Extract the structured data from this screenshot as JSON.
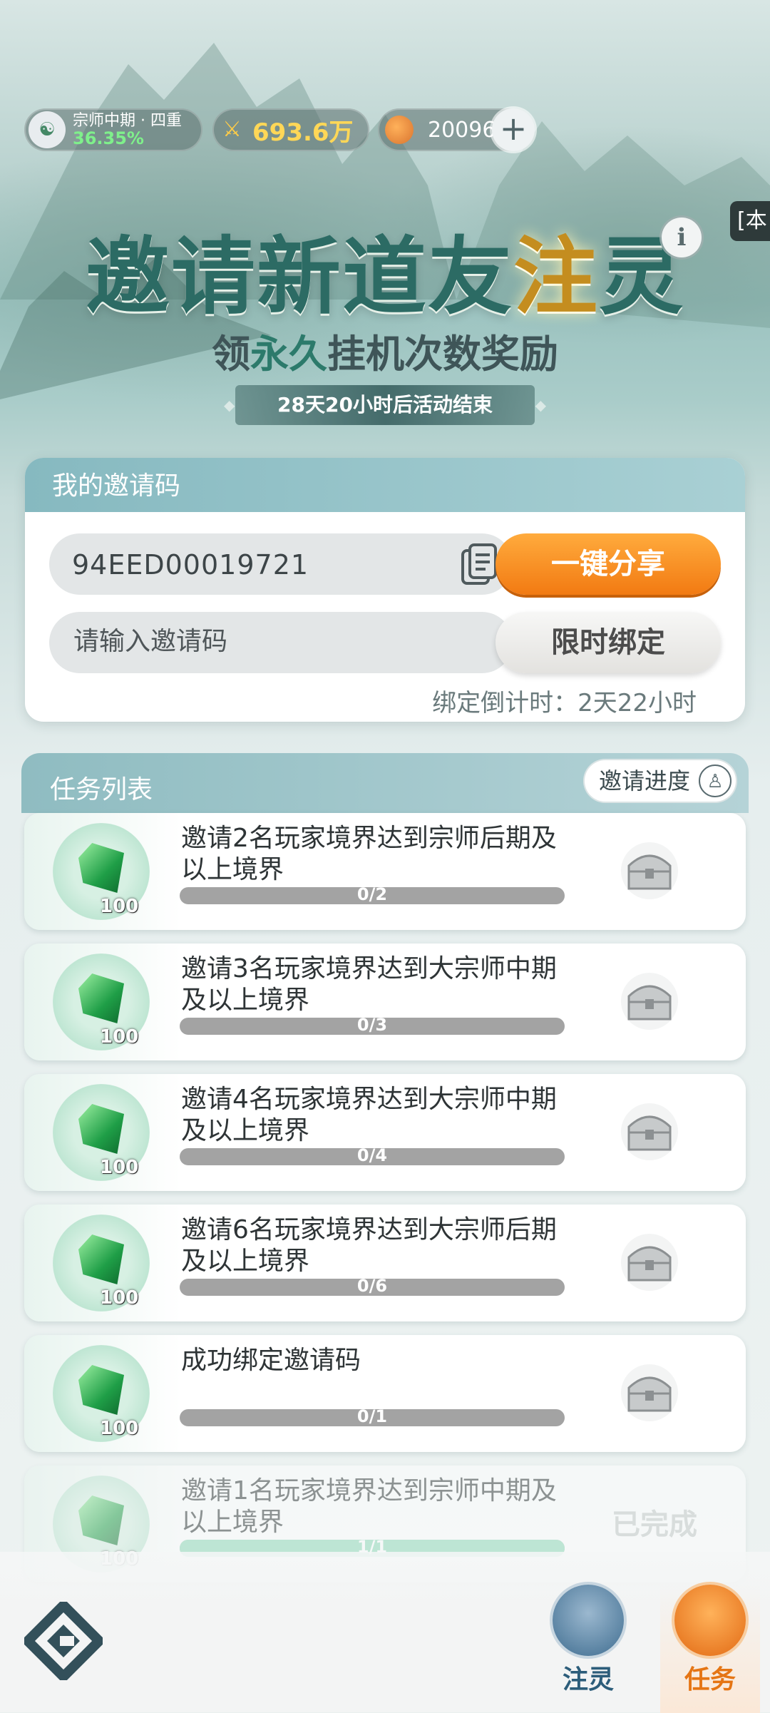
{
  "status_bar": {
    "realm": "宗师中期 · 四重",
    "realm_progress": "36.35%",
    "power": "693.6万",
    "currency": "20096"
  },
  "side_tab_label": "[本",
  "banner": {
    "title_part1": "邀请新道友",
    "title_part2": "注",
    "title_part3": "灵",
    "subtitle_part1": "领",
    "subtitle_part2": "永久",
    "subtitle_part3": "挂机次数奖励",
    "countdown": "28天20小时后活动结束"
  },
  "invite_card": {
    "header": "我的邀请码",
    "code": "94EED00019721",
    "share_label": "一键分享",
    "input_placeholder": "请输入邀请码",
    "bind_label": "限时绑定",
    "bind_countdown": "绑定倒计时：2天22小时"
  },
  "task_list": {
    "header": "任务列表",
    "progress_button": "邀请进度",
    "tasks": [
      {
        "text": "邀请2名玩家境界达到宗师后期及以上境界",
        "reward": "100",
        "progress_text": "0/2",
        "progress": 0
      },
      {
        "text": "邀请3名玩家境界达到大宗师中期及以上境界",
        "reward": "100",
        "progress_text": "0/3",
        "progress": 0
      },
      {
        "text": "邀请4名玩家境界达到大宗师中期及以上境界",
        "reward": "100",
        "progress_text": "0/4",
        "progress": 0
      },
      {
        "text": "邀请6名玩家境界达到大宗师后期及以上境界",
        "reward": "100",
        "progress_text": "0/6",
        "progress": 0
      },
      {
        "text": "成功绑定邀请码",
        "reward": "100",
        "progress_text": "0/1",
        "progress": 0
      },
      {
        "text": "邀请1名玩家境界达到宗师中期及以上境界",
        "reward": "100",
        "progress_text": "1/1",
        "progress": 1,
        "status": "已完成"
      }
    ]
  },
  "bottom_nav": {
    "items": [
      {
        "label": "注灵",
        "icon": "leaf-icon"
      },
      {
        "label": "任务",
        "icon": "scroll-icon",
        "active": true
      }
    ]
  },
  "colors": {
    "accent_orange": "#f27a12",
    "header_teal": "#86b9c0",
    "title_green": "#2c6b64"
  }
}
